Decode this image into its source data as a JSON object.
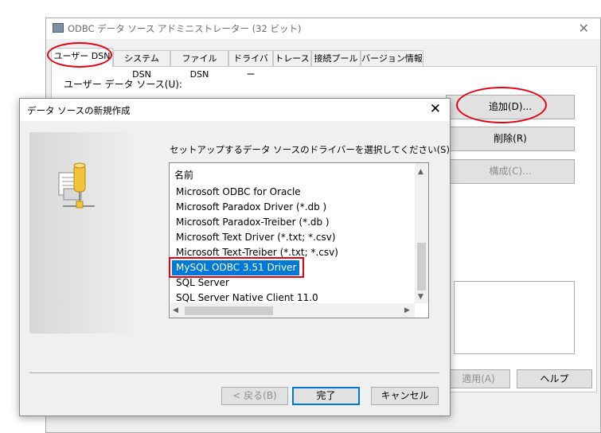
{
  "back_window": {
    "title": "ODBC データ ソース アドミニストレーター (32 ビット)",
    "tabs": [
      "ユーザー DSN",
      "システム DSN",
      "ファイル DSN",
      "ドライバー",
      "トレース",
      "接続プール",
      "バージョン情報"
    ],
    "user_ds_label": "ユーザー データ ソース(U):",
    "buttons": {
      "add": "追加(D)...",
      "remove": "削除(R)",
      "configure": "構成(C)...",
      "apply": "適用(A)",
      "help": "ヘルプ"
    }
  },
  "dialog": {
    "title": "データ ソースの新規作成",
    "prompt": "セットアップするデータ ソースのドライバーを選択してください(S)",
    "list_header": "名前",
    "drivers": [
      "Microsoft ODBC for Oracle",
      "Microsoft Paradox Driver (*.db )",
      "Microsoft Paradox-Treiber (*.db )",
      "Microsoft Text Driver (*.txt; *.csv)",
      "Microsoft Text-Treiber (*.txt; *.csv)",
      "MySQL ODBC 3.51 Driver",
      "SQL Server",
      "SQL Server Native Client 11.0"
    ],
    "selected_driver": "MySQL ODBC 3.51 Driver",
    "buttons": {
      "back": "< 戻る(B)",
      "finish": "完了",
      "cancel": "キャンセル"
    }
  },
  "icons": {
    "close": "✕",
    "scroll_up": "▲",
    "scroll_down": "▼",
    "scroll_left": "◀",
    "scroll_right": "▶"
  },
  "colors": {
    "selection": "#0078d7",
    "annotation": "#e60012"
  }
}
